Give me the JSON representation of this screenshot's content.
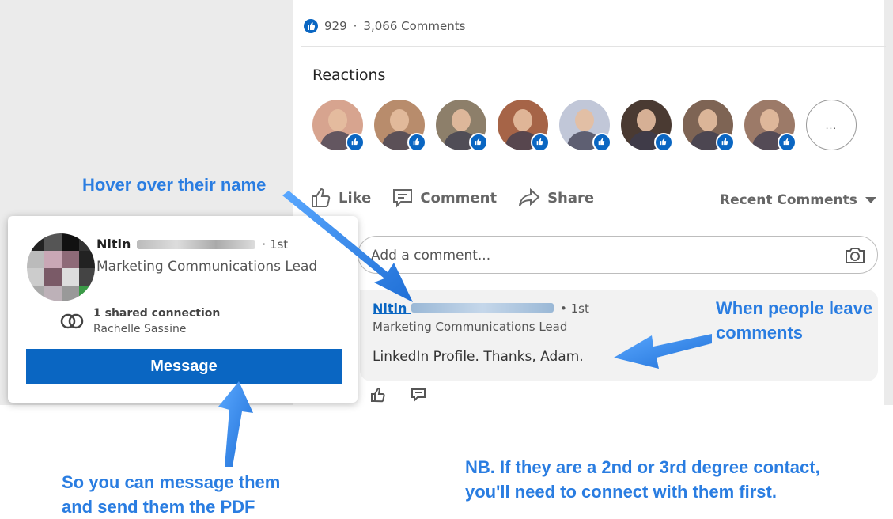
{
  "post_stats": {
    "reactions_count": "929",
    "separator": "·",
    "comments_count": "3,066 Comments"
  },
  "reactions": {
    "title": "Reactions",
    "people": [
      {
        "icon": "avatar-photo",
        "bg": "#d7a48f"
      },
      {
        "icon": "avatar-photo",
        "bg": "#b88c6c"
      },
      {
        "icon": "avatar-photo",
        "bg": "#8d7f6a"
      },
      {
        "icon": "avatar-photo",
        "bg": "#a66447"
      },
      {
        "icon": "avatar-photo",
        "bg": "#c1c7d8"
      },
      {
        "icon": "avatar-photo",
        "bg": "#4a3a32"
      },
      {
        "icon": "avatar-photo",
        "bg": "#7e6454"
      },
      {
        "icon": "avatar-photo",
        "bg": "#9c7a68"
      }
    ],
    "more_label": "..."
  },
  "actions": {
    "like": "Like",
    "comment": "Comment",
    "share": "Share",
    "sort": "Recent Comments"
  },
  "comment_input": {
    "placeholder": "Add a comment..."
  },
  "comment": {
    "author_first": "Nitin",
    "degree": "• 1st",
    "title": "Marketing Communications Lead",
    "text": "LinkedIn Profile. Thanks, Adam."
  },
  "hover_card": {
    "name_first": "Nitin",
    "degree": "· 1st",
    "title": "Marketing Communications Lead",
    "shared_connections": "1 shared connection",
    "connection_name": "Rachelle Sassine",
    "message_button": "Message"
  },
  "annotations": {
    "hover_name": "Hover over their name",
    "people_comment_line1": "When people leave",
    "people_comment_line2": "comments",
    "message_line1": "So you can message them",
    "message_line2": "and send them the PDF",
    "nb_line1": "NB.  If they are a 2nd or 3rd degree contact,",
    "nb_line2": "you'll need to connect with them first."
  },
  "colors": {
    "brand_blue": "#0a66c2",
    "annotation_blue": "#2a7de1"
  }
}
